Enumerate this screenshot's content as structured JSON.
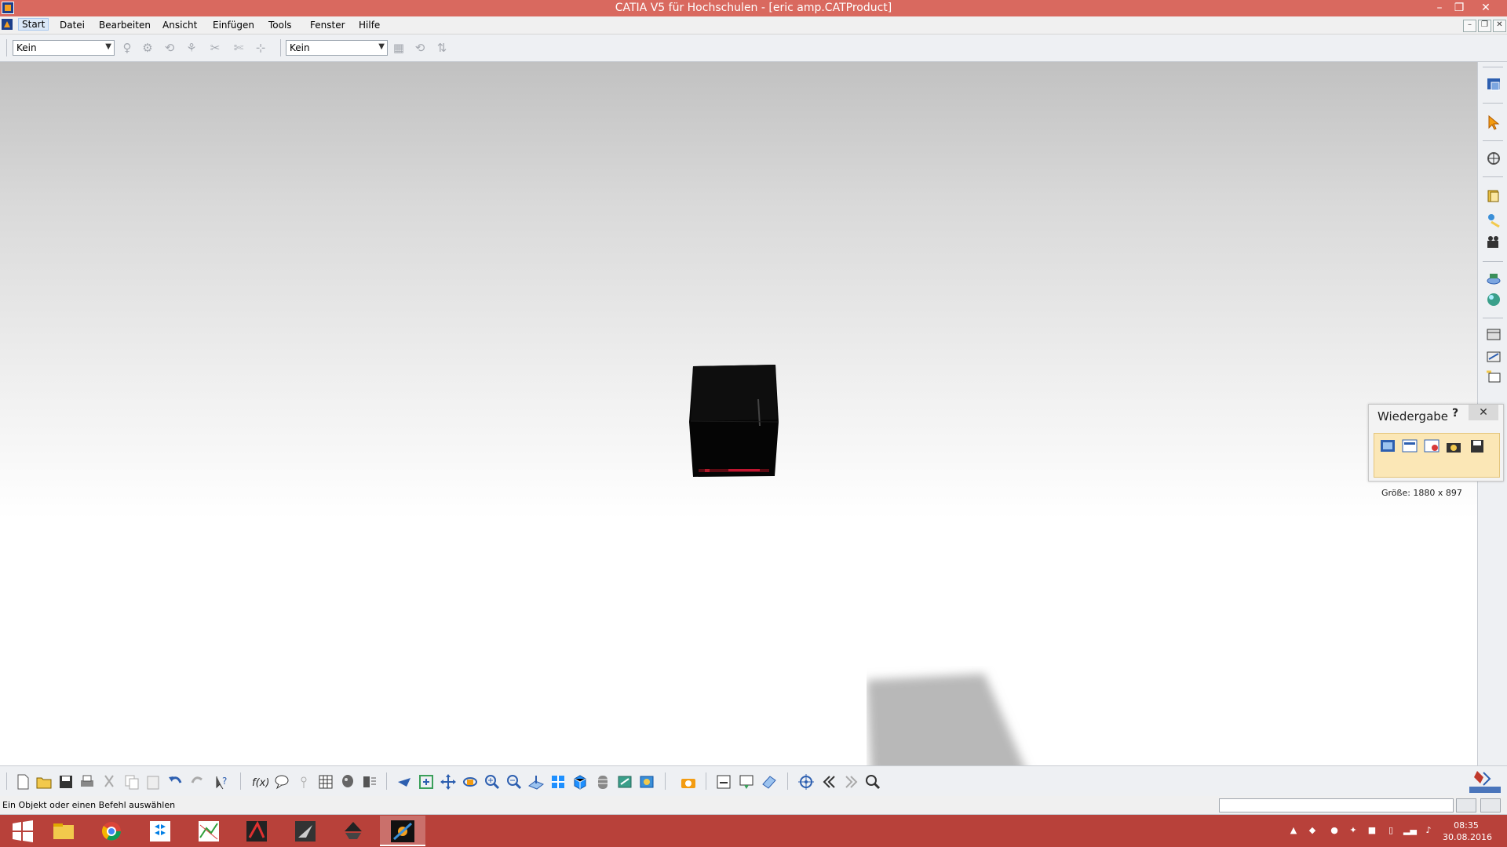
{
  "window": {
    "title": "CATIA V5 für Hochschulen - [eric amp.CATProduct]",
    "minimize": "–",
    "restore": "❐",
    "close": "✕"
  },
  "menu": {
    "items": [
      {
        "label": "Start",
        "active": true
      },
      {
        "label": "Datei"
      },
      {
        "label": "Bearbeiten"
      },
      {
        "label": "Ansicht"
      },
      {
        "label": "Einfügen"
      },
      {
        "label": "Tools"
      },
      {
        "label": "Fenster"
      },
      {
        "label": "Hilfe"
      }
    ],
    "mdi": {
      "minimize": "–",
      "restore": "❐",
      "close": "✕"
    }
  },
  "toolbar_top": {
    "select1_value": "Kein",
    "select2_value": "Kein"
  },
  "playback_panel": {
    "title": "Wiedergabe",
    "help": "?",
    "close": "✕",
    "size_label": "Größe: 1880 x 897"
  },
  "status": {
    "message": "Ein Objekt oder einen Befehl auswählen"
  },
  "taskbar": {
    "time": "08:35",
    "date": "30.08.2016"
  },
  "colors": {
    "titlebar": "#d9695f",
    "taskbar": "#b8413a",
    "panel_accent": "#fbe7b6"
  }
}
